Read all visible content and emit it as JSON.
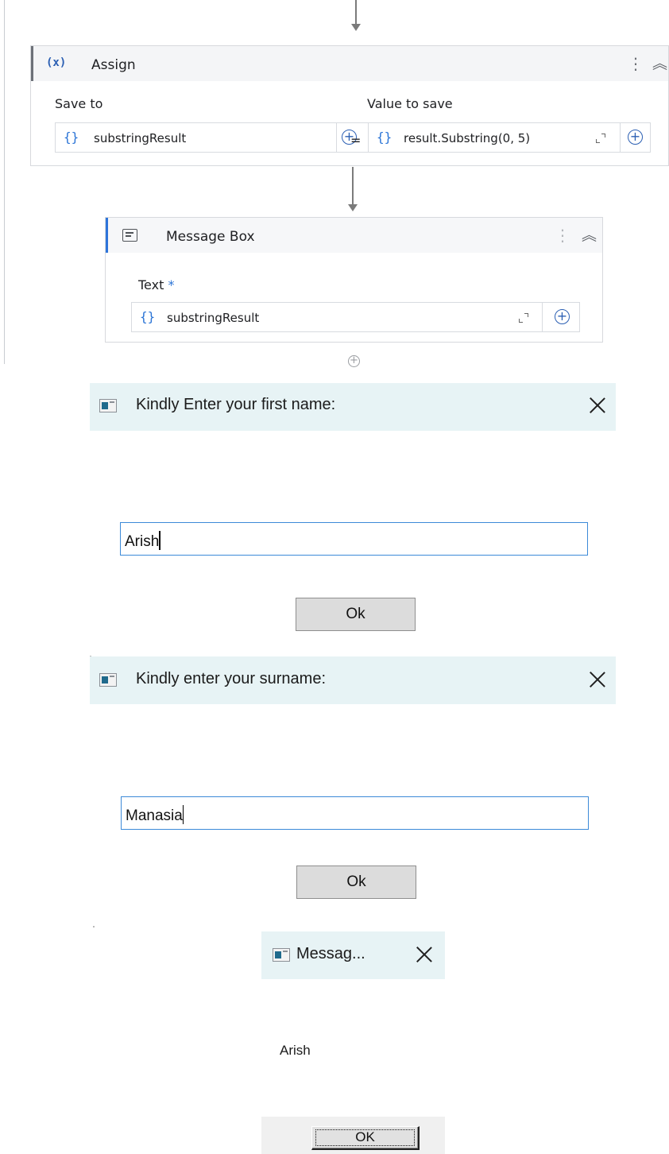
{
  "assign": {
    "title": "Assign",
    "icon_text": "(x)",
    "save_to_label": "Save to",
    "value_to_save_label": "Value to save",
    "save_to_value": "substringResult",
    "value_to_save_value": "result.Substring(0, 5)",
    "brace": "{}",
    "equals": "=",
    "plus": "+",
    "kebab": "⋮",
    "collapse": "︽"
  },
  "message_box_activity": {
    "title": "Message Box",
    "text_label": "Text",
    "required_marker": "*",
    "text_value": "substringResult",
    "brace": "{}",
    "plus": "+",
    "kebab": "⋮",
    "collapse": "︽"
  },
  "add_activity": "+",
  "dialog_first_name": {
    "title": "Kindly Enter your first name:",
    "input_value": "Arish",
    "ok_label": "Ok"
  },
  "dialog_surname": {
    "title": "Kindly enter your surname:",
    "input_value": "Manasia",
    "ok_label": "Ok"
  },
  "result_dialog": {
    "title": "Messag...",
    "message": "Arish",
    "ok_label": "OK"
  },
  "colors": {
    "accent_blue": "#2d74da",
    "dialog_titlebar": "#e7f3f5",
    "input_border": "#3c8ad8"
  },
  "icons": [
    "arrow-down-icon",
    "variable-icon",
    "kebab-icon",
    "collapse-icon",
    "braces-icon",
    "plus-circle-icon",
    "expand-icon",
    "message-box-icon",
    "window-icon",
    "close-icon"
  ]
}
